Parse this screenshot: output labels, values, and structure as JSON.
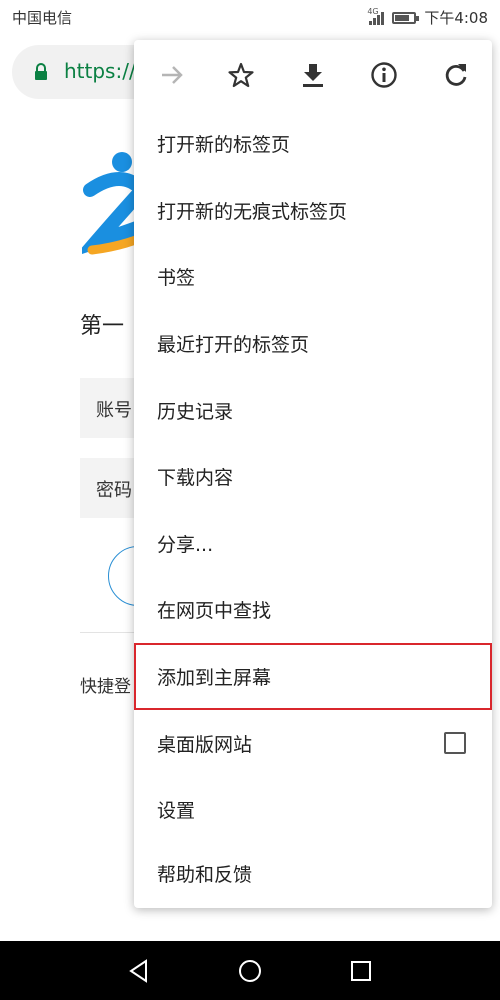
{
  "status_bar": {
    "carrier": "中国电信",
    "network": "4G",
    "time": "下午4:08"
  },
  "url_bar": {
    "url": "https://"
  },
  "page": {
    "title": "第一",
    "account_label": "账号",
    "password_label": "密码",
    "quick_login": "快捷登"
  },
  "menu": {
    "icons": [
      "forward-arrow-icon",
      "star-icon",
      "download-icon",
      "info-icon",
      "refresh-icon"
    ],
    "items": [
      {
        "label": "打开新的标签页"
      },
      {
        "label": "打开新的无痕式标签页"
      },
      {
        "label": "书签"
      },
      {
        "label": "最近打开的标签页"
      },
      {
        "label": "历史记录"
      },
      {
        "label": "下载内容"
      },
      {
        "label": "分享..."
      },
      {
        "label": "在网页中查找"
      },
      {
        "label": "添加到主屏幕"
      },
      {
        "label": "桌面版网站"
      },
      {
        "label": "设置"
      },
      {
        "label": "帮助和反馈"
      }
    ],
    "highlight_color": "#d9262c"
  },
  "colors": {
    "url_green": "#0b8043",
    "logo_blue": "#1a8fe0",
    "logo_yellow": "#f5a623"
  }
}
